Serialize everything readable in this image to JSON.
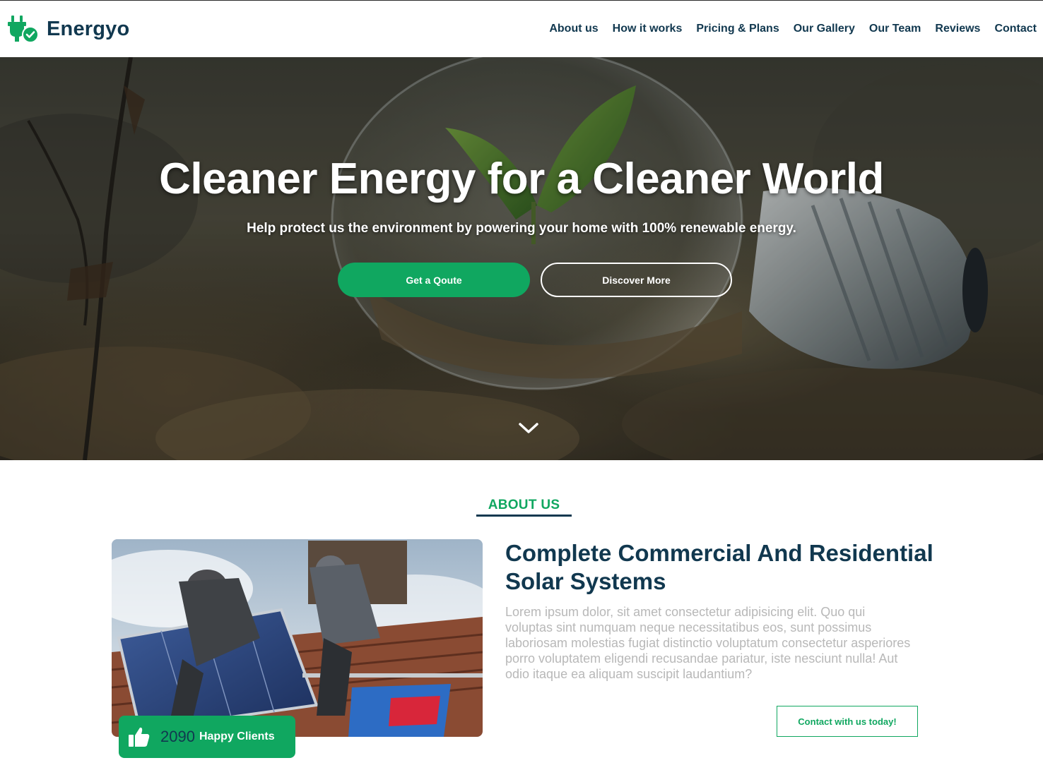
{
  "brand": {
    "name": "Energyo",
    "logo_icon": "plug-check-icon",
    "primary_color": "#10a760",
    "dark_color": "#11384f"
  },
  "nav": {
    "items": [
      {
        "label": "About us"
      },
      {
        "label": "How it works"
      },
      {
        "label": "Pricing & Plans"
      },
      {
        "label": "Our Gallery"
      },
      {
        "label": "Our Team"
      },
      {
        "label": "Reviews"
      },
      {
        "label": "Contact"
      }
    ]
  },
  "hero": {
    "title": "Cleaner Energy for a Cleaner World",
    "subtitle": "Help protect us the environment by powering your home with 100% renewable energy.",
    "primary_button": "Get a Qoute",
    "secondary_button": "Discover More",
    "scroll_icon": "chevron-down-icon"
  },
  "about": {
    "label": "ABOUT US",
    "heading": "Complete Commercial And Residential Solar Systems",
    "body": "Lorem ipsum dolor, sit amet consectetur adipisicing elit. Quo qui voluptas sint numquam neque necessitatibus eos, sunt possimus laboriosam molestias fugiat distinctio voluptatum consectetur asperiores porro voluptatem eligendi recusandae pariatur, iste nesciunt nulla! Aut odio itaque ea aliquam suscipit laudantium?",
    "badge": {
      "icon": "thumbs-up-icon",
      "count": "2090",
      "text": "Happy Clients"
    },
    "cta_button": "Contact with us today!"
  }
}
